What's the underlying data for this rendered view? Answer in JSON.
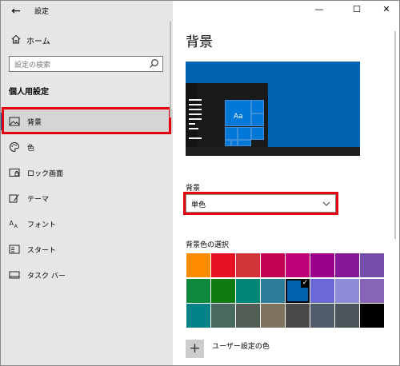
{
  "window": {
    "title": "設定"
  },
  "sidebar": {
    "home_label": "ホーム",
    "search_placeholder": "設定の検索",
    "section_heading": "個人用設定",
    "items": [
      {
        "label": "背景",
        "icon": "picture-icon"
      },
      {
        "label": "色",
        "icon": "palette-icon"
      },
      {
        "label": "ロック画面",
        "icon": "lock-screen-icon"
      },
      {
        "label": "テーマ",
        "icon": "theme-icon"
      },
      {
        "label": "フォント",
        "icon": "font-icon"
      },
      {
        "label": "スタート",
        "icon": "start-icon"
      },
      {
        "label": "タスク バー",
        "icon": "taskbar-icon"
      }
    ],
    "selected_index": 0
  },
  "window_controls": {
    "minimize": "—",
    "maximize": "☐",
    "close": "✕"
  },
  "main": {
    "title": "背景",
    "preview": {
      "sample_text": "Aa"
    },
    "background_label": "背景",
    "background_value": "単色",
    "color_section_label": "背景色の選択",
    "swatches": [
      "#ff8c00",
      "#e81123",
      "#d13438",
      "#c30052",
      "#bf0077",
      "#9a0089",
      "#881798",
      "#744da9",
      "#10893e",
      "#107c10",
      "#018574",
      "#2d7d9a",
      "#0063b1",
      "#6b69d6",
      "#8e8cd8",
      "#8764b8",
      "#038387",
      "#486860",
      "#525e54",
      "#7e735f",
      "#4c4a48",
      "#515c6b",
      "#4a5459",
      "#000000"
    ],
    "selected_swatch": 12,
    "custom_color_label": "ユーザー設定の色",
    "accent": "#0063b1",
    "highlight": "#e60012"
  }
}
